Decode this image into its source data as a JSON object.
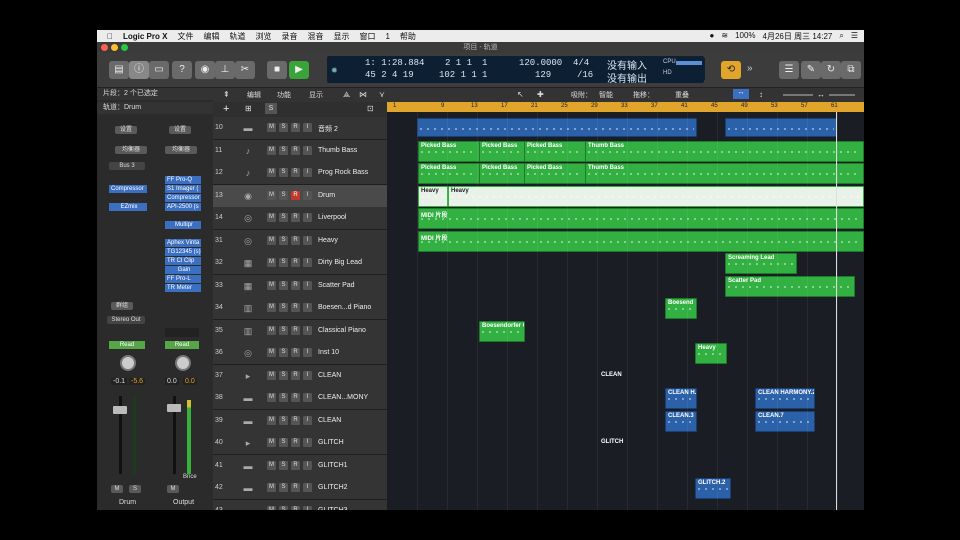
{
  "menubar": {
    "app_name": "Logic Pro X",
    "menus": [
      "文件",
      "编辑",
      "轨道",
      "浏览",
      "录音",
      "混音",
      "显示",
      "窗口",
      "1",
      "帮助"
    ],
    "battery": "100%",
    "datetime": "4月26日 周三 14:27"
  },
  "window_title": "项目 - 轨道",
  "lcd": {
    "time": "1: 1:28.884",
    "time_sub": "2 1 1",
    "time_tick": "1",
    "bars": "45 2 4 19",
    "bars_sub": "102 1 1",
    "bars_tick": "1",
    "tempo": "120.0000",
    "tempo_sub": "129",
    "sig": "4/4",
    "sig_sub": "/16",
    "input": "没有输入",
    "output": "没有输出",
    "cpu_label": "CPU",
    "hd_label": "HD"
  },
  "inspector": {
    "region_header": "片段：2 个已选定",
    "track_header": "轨道：Drum",
    "settings": "设置",
    "eq": "均衡器",
    "bus": "Bus 3",
    "left_plugins": [
      "Compressor",
      "EZmix"
    ],
    "right_plugins": [
      "FF Pro-Q",
      "S1 Imager (",
      "Compressor",
      "API-2500 (s"
    ],
    "multipr": "Multipr",
    "right_plugins2": [
      "Aphex Vinta",
      "TG12345 (s)",
      "TR Cl Clip",
      "Gain",
      "FF Pro-L",
      "TR Meter"
    ],
    "group": "群组",
    "stereo_out": "Stereo Out",
    "read": "Read",
    "left_values": [
      "-0.1",
      "-5.6"
    ],
    "right_values": [
      "0.0",
      "0.0"
    ],
    "bnce": "Bnce",
    "m": "M",
    "s": "S",
    "left_name": "Drum",
    "right_name": "Output"
  },
  "track_toolbar": {
    "edit": "编辑",
    "function": "功能",
    "view": "显示",
    "snap_label": "吸附：",
    "snap_value": "智能",
    "drag_label": "拖移：",
    "drag_value": "重叠",
    "add": "+",
    "s_btn": "S"
  },
  "tracks": [
    {
      "num": "10",
      "name": "音频 2",
      "icon": "waveform-icon"
    },
    {
      "num": "11",
      "name": "Thumb Bass",
      "icon": "bass-guitar-icon"
    },
    {
      "num": "12",
      "name": "Prog Rock Bass",
      "icon": "bass-guitar-icon"
    },
    {
      "num": "13",
      "name": "Drum",
      "icon": "drum-icon"
    },
    {
      "num": "14",
      "name": "Liverpool",
      "icon": "drumkit-icon"
    },
    {
      "num": "31",
      "name": "Heavy",
      "icon": "drumkit-icon"
    },
    {
      "num": "32",
      "name": "Dirty Big Lead",
      "icon": "synth-icon"
    },
    {
      "num": "33",
      "name": "Scatter Pad",
      "icon": "synth-icon"
    },
    {
      "num": "34",
      "name": "Boesen...d Piano",
      "icon": "piano-icon"
    },
    {
      "num": "35",
      "name": "Classical Piano",
      "icon": "piano-icon"
    },
    {
      "num": "36",
      "name": "Inst 10",
      "icon": "drumkit-icon"
    },
    {
      "num": "37",
      "name": "CLEAN",
      "icon": "folder-icon"
    },
    {
      "num": "38",
      "name": "CLEAN...MONY",
      "icon": "waveform-icon"
    },
    {
      "num": "39",
      "name": "CLEAN",
      "icon": "waveform-icon"
    },
    {
      "num": "40",
      "name": "GLITCH",
      "icon": "folder-icon"
    },
    {
      "num": "41",
      "name": "GLITCH1",
      "icon": "waveform-icon"
    },
    {
      "num": "42",
      "name": "GLITCH2",
      "icon": "waveform-icon"
    },
    {
      "num": "43",
      "name": "GLITCH3",
      "icon": "waveform-icon"
    }
  ],
  "ruler_marks": [
    "1",
    "9",
    "13",
    "17",
    "21",
    "25",
    "29",
    "33",
    "37",
    "41",
    "45",
    "49",
    "53",
    "57",
    "61"
  ],
  "regions": {
    "picked_bass": "Picked Bass",
    "thumb_bass": "Thumb Bass",
    "heavy": "Heavy",
    "midi": "MIDI 片段",
    "screaming_lead": "Screaming Lead",
    "scatter_pad": "Scatter Pad",
    "boesendorfer_short": "Boesend",
    "boesendorfer": "Boesendorfer G",
    "clean_folder": "CLEAN",
    "clean_h": "CLEAN H.",
    "clean_harmony": "CLEAN HARMONY.2",
    "clean3": "CLEAN.3",
    "clean7": "CLEAN.7",
    "glitch_folder": "GLITCH",
    "glitch2": "GLITCH.2"
  },
  "colors": {
    "accent_green": "#33b042",
    "audio_blue": "#2a61a8",
    "ruler": "#e0a52a",
    "record_red": "#c0392b"
  }
}
